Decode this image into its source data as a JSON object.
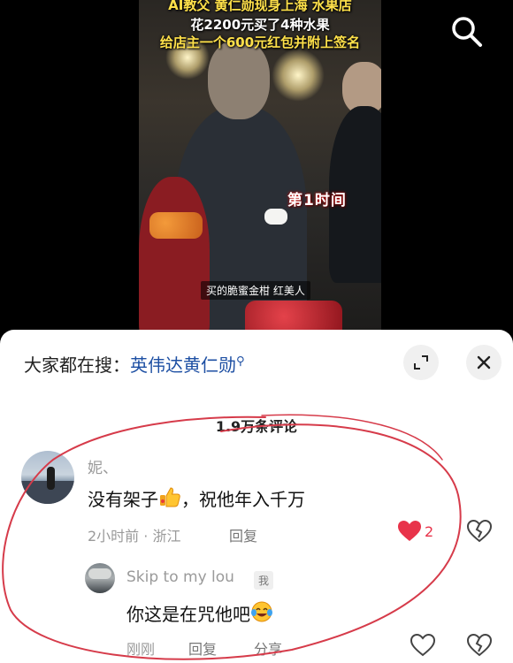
{
  "video": {
    "headline_line1": "AI教父 黄仁勋现身上海 水果店",
    "headline_line2": "花2200元买了4种水果",
    "headline_line3": "给店主一个600元红包并附上签名",
    "caption": "买的脆蜜金柑 红美人",
    "logo_text": "第1时间"
  },
  "search": {
    "icon": "search-icon"
  },
  "sheet": {
    "suggest_label": "大家都在搜：",
    "suggest_term": "英伟达黄仁勋",
    "expand_icon": "expand-icon",
    "close_icon": "close-icon",
    "comment_count_title": "1.9万条评论"
  },
  "comments": [
    {
      "username": "妮、",
      "text": "没有架子",
      "emoji": "thumbs-up",
      "text_after": "，祝他年入千万",
      "time": "2小时前 · 浙江",
      "reply_label": "回复",
      "likes": "2",
      "liked": true,
      "reply": {
        "username": "Skip to my lou",
        "badge": "我",
        "text": "你这是在咒他吧",
        "emoji": "laughing-tears",
        "time": "刚刚",
        "reply_label": "回复",
        "share_label": "分享"
      }
    }
  ],
  "colors": {
    "link_blue": "#1d4fa3",
    "like_red": "#e8334a",
    "annotation_red": "#d63b4a"
  }
}
